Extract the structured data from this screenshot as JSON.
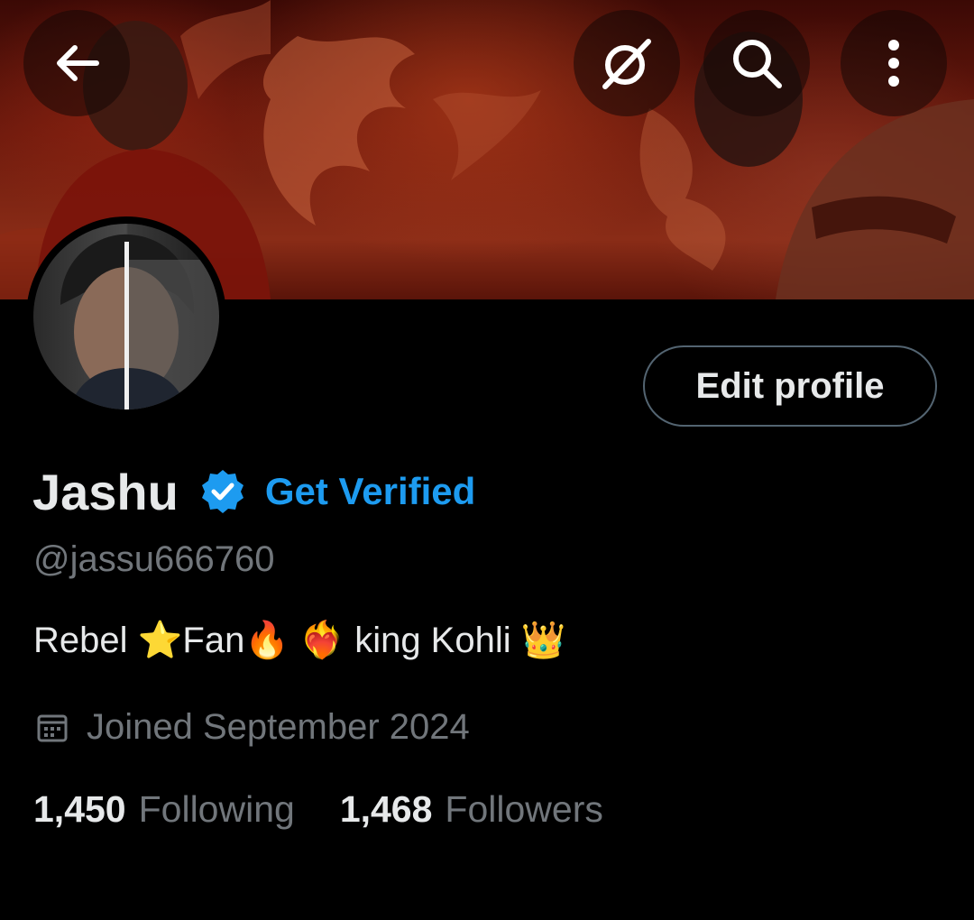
{
  "header": {
    "back_icon": "arrow-left-icon",
    "action_icons": [
      "grok-slash-icon",
      "search-icon",
      "more-vertical-icon"
    ]
  },
  "profile": {
    "name": "Jashu",
    "verified_badge_color": "#1d9bf0",
    "get_verified_label": "Get Verified",
    "handle": "@jassu666760",
    "bio": "Rebel ⭐Fan🔥 ❤️‍🔥 king Kohli 👑",
    "joined": "Joined September 2024",
    "edit_profile_label": "Edit profile"
  },
  "stats": {
    "following_count": "1,450",
    "following_label": "Following",
    "followers_count": "1,468",
    "followers_label": "Followers"
  },
  "colors": {
    "background": "#000000",
    "accent": "#1d9bf0",
    "muted_text": "#71767b",
    "primary_text": "#e7e9ea"
  }
}
